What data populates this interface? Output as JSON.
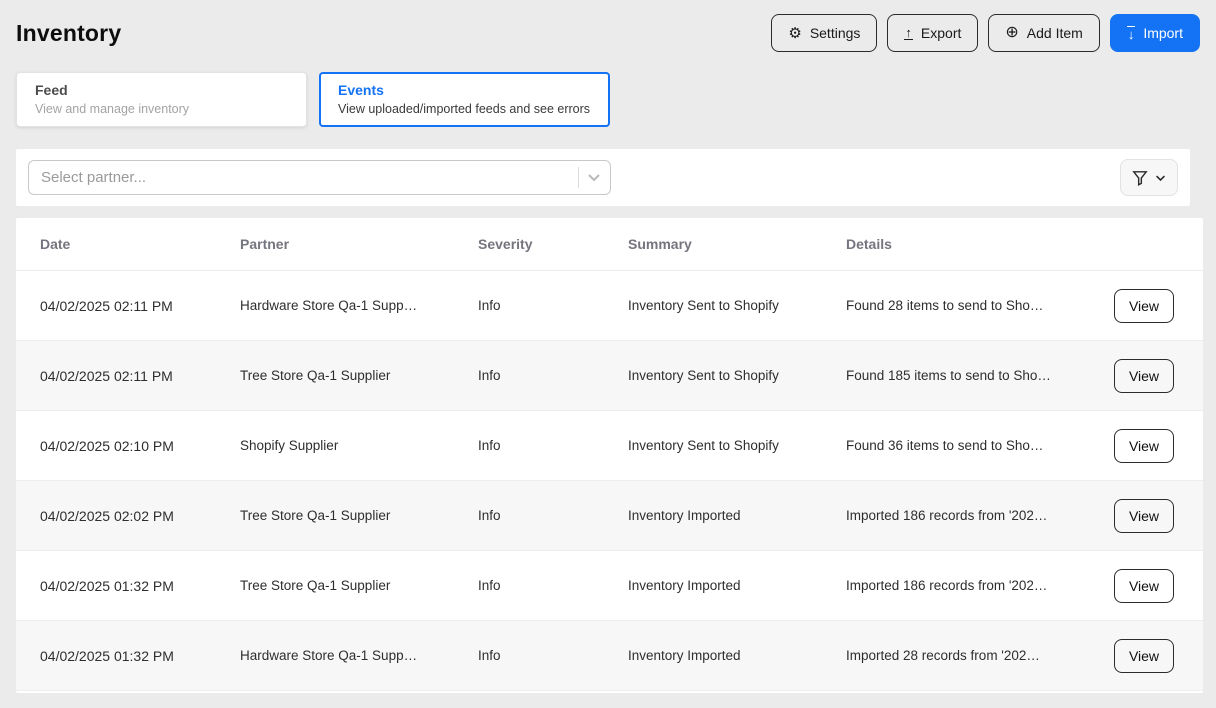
{
  "page": {
    "title": "Inventory"
  },
  "actions": [
    {
      "label": "Settings",
      "icon": "gear-icon"
    },
    {
      "label": "Export",
      "icon": "export-icon"
    },
    {
      "label": "Add Item",
      "icon": "add-item-icon"
    },
    {
      "label": "Import",
      "icon": "import-icon"
    }
  ],
  "tabs": [
    {
      "label": "Feed",
      "description": "View and manage inventory",
      "active": false
    },
    {
      "label": "Events",
      "description": "View uploaded/imported feeds and see errors",
      "active": true
    }
  ],
  "filters": {
    "partner_placeholder": "Select partner..."
  },
  "table": {
    "columns": [
      "Date",
      "Partner",
      "Severity",
      "Summary",
      "Details"
    ],
    "action_label": "View",
    "rows": [
      {
        "date": "04/02/2025 02:11 PM",
        "partner": "Hardware Store Qa-1 Supp…",
        "severity": "Info",
        "summary": "Inventory Sent to Shopify",
        "details": "Found 28 items to send to Sho…"
      },
      {
        "date": "04/02/2025 02:11 PM",
        "partner": "Tree Store Qa-1 Supplier",
        "severity": "Info",
        "summary": "Inventory Sent to Shopify",
        "details": "Found 185 items to send to Sho…"
      },
      {
        "date": "04/02/2025 02:10 PM",
        "partner": "Shopify Supplier",
        "severity": "Info",
        "summary": "Inventory Sent to Shopify",
        "details": "Found 36 items to send to Sho…"
      },
      {
        "date": "04/02/2025 02:02 PM",
        "partner": "Tree Store Qa-1 Supplier",
        "severity": "Info",
        "summary": "Inventory Imported",
        "details": "Imported 186 records from '202…"
      },
      {
        "date": "04/02/2025 01:32 PM",
        "partner": "Tree Store Qa-1 Supplier",
        "severity": "Info",
        "summary": "Inventory Imported",
        "details": "Imported 186 records from '202…"
      },
      {
        "date": "04/02/2025 01:32 PM",
        "partner": "Hardware Store Qa-1 Supp…",
        "severity": "Info",
        "summary": "Inventory Imported",
        "details": "Imported 28 records from '202…"
      }
    ]
  },
  "colors": {
    "accent_blue": "#1473f4",
    "page_background": "#ebebeb",
    "row_alt_background": "#f7f7f7"
  }
}
